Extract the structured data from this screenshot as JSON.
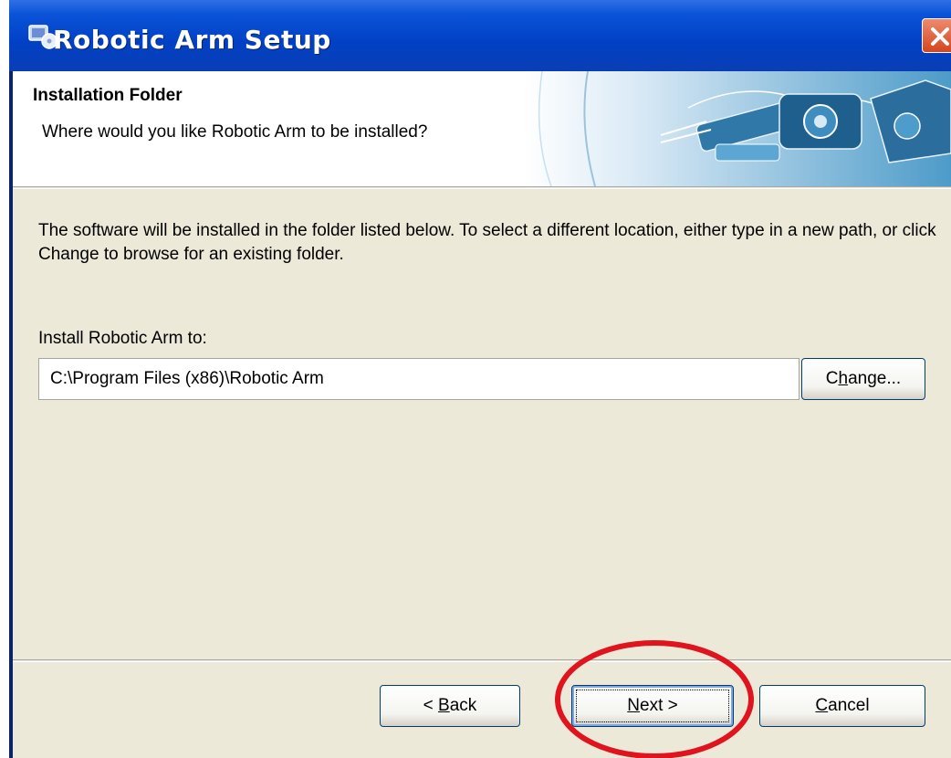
{
  "window": {
    "title": "Robotic Arm Setup",
    "close_icon": "close-icon"
  },
  "header": {
    "title": "Installation Folder",
    "subtitle": "Where would you like Robotic Arm to be installed?"
  },
  "body": {
    "description": "The software will be installed in the folder listed below. To select a different location, either type in a new path, or click Change to browse for an existing folder.",
    "install_label": "Install Robotic Arm to:",
    "install_path": "C:\\Program Files (x86)\\Robotic Arm"
  },
  "buttons": {
    "change_pre": "C",
    "change_ul": "h",
    "change_post": "ange...",
    "back_pre": "< ",
    "back_ul": "B",
    "back_post": "ack",
    "next_ul": "N",
    "next_post": "ext >",
    "cancel_ul": "C",
    "cancel_post": "ancel"
  },
  "colors": {
    "highlight": "#E0141E",
    "title_bar": "#0A53D8",
    "dialog_bg": "#ECE9D8"
  }
}
